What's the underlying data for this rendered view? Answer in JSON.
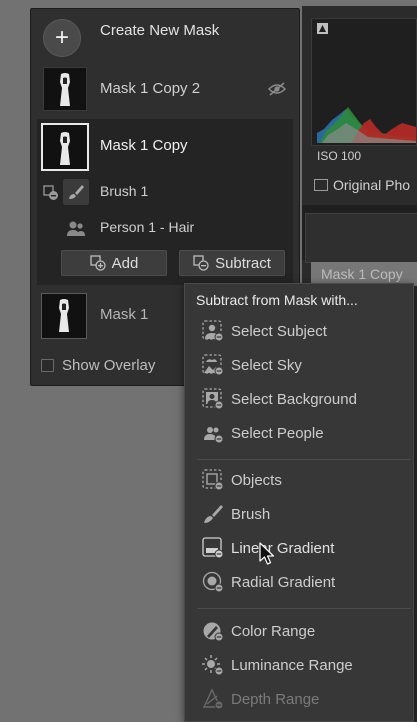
{
  "masks_panel": {
    "create_label": "Create New Mask",
    "masks": [
      {
        "label": "Mask 1 Copy 2",
        "state": "hidden-visibility",
        "icon": "eye-slash-icon"
      },
      {
        "label": "Mask 1 Copy",
        "state": "selected"
      },
      {
        "label": "Mask 1",
        "state": "normal"
      }
    ],
    "components": [
      {
        "label": "Brush 1",
        "icon": "brush-icon"
      },
      {
        "label": "Person 1 - Hair",
        "icon": "person-icon"
      }
    ],
    "add_label": "Add",
    "subtract_label": "Subtract",
    "show_overlay_label": "Show Overlay",
    "show_overlay_checked": false
  },
  "right_panel": {
    "iso": "ISO 100",
    "original_label": "Original Pho",
    "card_label": "Mask 1 Copy"
  },
  "menu": {
    "title": "Subtract from Mask with...",
    "groups": [
      [
        {
          "label": "Select Subject",
          "icon": "select-subject-icon",
          "enabled": true
        },
        {
          "label": "Select Sky",
          "icon": "select-sky-icon",
          "enabled": true
        },
        {
          "label": "Select Background",
          "icon": "select-background-icon",
          "enabled": true
        },
        {
          "label": "Select People",
          "icon": "select-people-icon",
          "enabled": true
        }
      ],
      [
        {
          "label": "Objects",
          "icon": "objects-icon",
          "enabled": true
        },
        {
          "label": "Brush",
          "icon": "brush-icon",
          "enabled": true
        },
        {
          "label": "Linear Gradient",
          "icon": "linear-gradient-icon",
          "enabled": true
        },
        {
          "label": "Radial Gradient",
          "icon": "radial-gradient-icon",
          "enabled": true
        }
      ],
      [
        {
          "label": "Color Range",
          "icon": "color-range-icon",
          "enabled": true
        },
        {
          "label": "Luminance Range",
          "icon": "luminance-range-icon",
          "enabled": true
        },
        {
          "label": "Depth Range",
          "icon": "depth-range-icon",
          "enabled": false
        }
      ]
    ]
  },
  "colors": {
    "background": "#727272",
    "panel": "#2f2f2f",
    "menu": "#373737",
    "text": "#d8d8d8",
    "disabled_text": "#7a7a7a"
  }
}
